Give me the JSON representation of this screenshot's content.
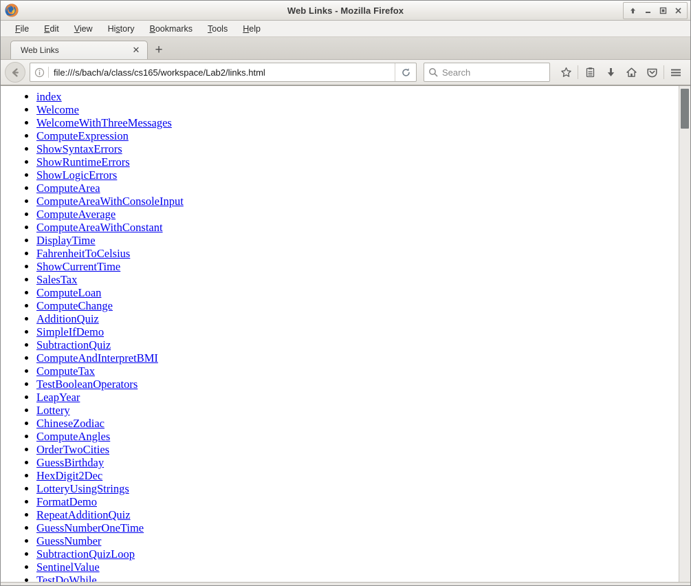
{
  "window": {
    "title": "Web Links - Mozilla Firefox",
    "logo_icon": "firefox-logo",
    "controls": [
      {
        "name": "shade-button",
        "glyph": "⇧"
      },
      {
        "name": "minimize-button",
        "glyph": "–"
      },
      {
        "name": "maximize-button",
        "glyph": "□"
      },
      {
        "name": "close-button",
        "glyph": "✕"
      }
    ]
  },
  "menubar": {
    "items": [
      {
        "label": "File",
        "mnemonic": "F"
      },
      {
        "label": "Edit",
        "mnemonic": "E"
      },
      {
        "label": "View",
        "mnemonic": "V"
      },
      {
        "label": "History",
        "mnemonic": "s"
      },
      {
        "label": "Bookmarks",
        "mnemonic": "B"
      },
      {
        "label": "Tools",
        "mnemonic": "T"
      },
      {
        "label": "Help",
        "mnemonic": "H"
      }
    ]
  },
  "tabbar": {
    "tabs": [
      {
        "title": "Web Links",
        "close_glyph": "✕"
      }
    ],
    "new_tab_glyph": "+"
  },
  "navbar": {
    "back_icon": "back-arrow-icon",
    "identity_icon": "info-circle-icon",
    "url": "file:///s/bach/a/class/cs165/workspace/Lab2/links.html",
    "reload_icon": "reload-icon",
    "search": {
      "icon": "search-icon",
      "placeholder": "Search",
      "value": ""
    },
    "tools": [
      {
        "name": "bookmark-star-icon"
      },
      {
        "name": "library-icon"
      },
      {
        "name": "downloads-icon"
      },
      {
        "name": "home-icon"
      },
      {
        "name": "pocket-icon"
      },
      {
        "name": "menu-hamburger-icon"
      }
    ]
  },
  "page": {
    "links": [
      "index",
      "Welcome",
      "WelcomeWithThreeMessages",
      "ComputeExpression",
      "ShowSyntaxErrors",
      "ShowRuntimeErrors",
      "ShowLogicErrors",
      "ComputeArea",
      "ComputeAreaWithConsoleInput",
      "ComputeAverage",
      "ComputeAreaWithConstant",
      "DisplayTime",
      "FahrenheitToCelsius",
      "ShowCurrentTime",
      "SalesTax",
      "ComputeLoan",
      "ComputeChange",
      "AdditionQuiz",
      "SimpleIfDemo",
      "SubtractionQuiz",
      "ComputeAndInterpretBMI",
      "ComputeTax",
      "TestBooleanOperators",
      "LeapYear",
      "Lottery",
      "ChineseZodiac",
      "ComputeAngles",
      "OrderTwoCities",
      "GuessBirthday",
      "HexDigit2Dec",
      "LotteryUsingStrings",
      "FormatDemo",
      "RepeatAdditionQuiz",
      "GuessNumberOneTime",
      "GuessNumber",
      "SubtractionQuizLoop",
      "SentinelValue",
      "TestDoWhile"
    ],
    "link_color": "#0000ee"
  },
  "scrollbar": {
    "orientation": "vertical",
    "thumb_color": "#7c8081"
  }
}
